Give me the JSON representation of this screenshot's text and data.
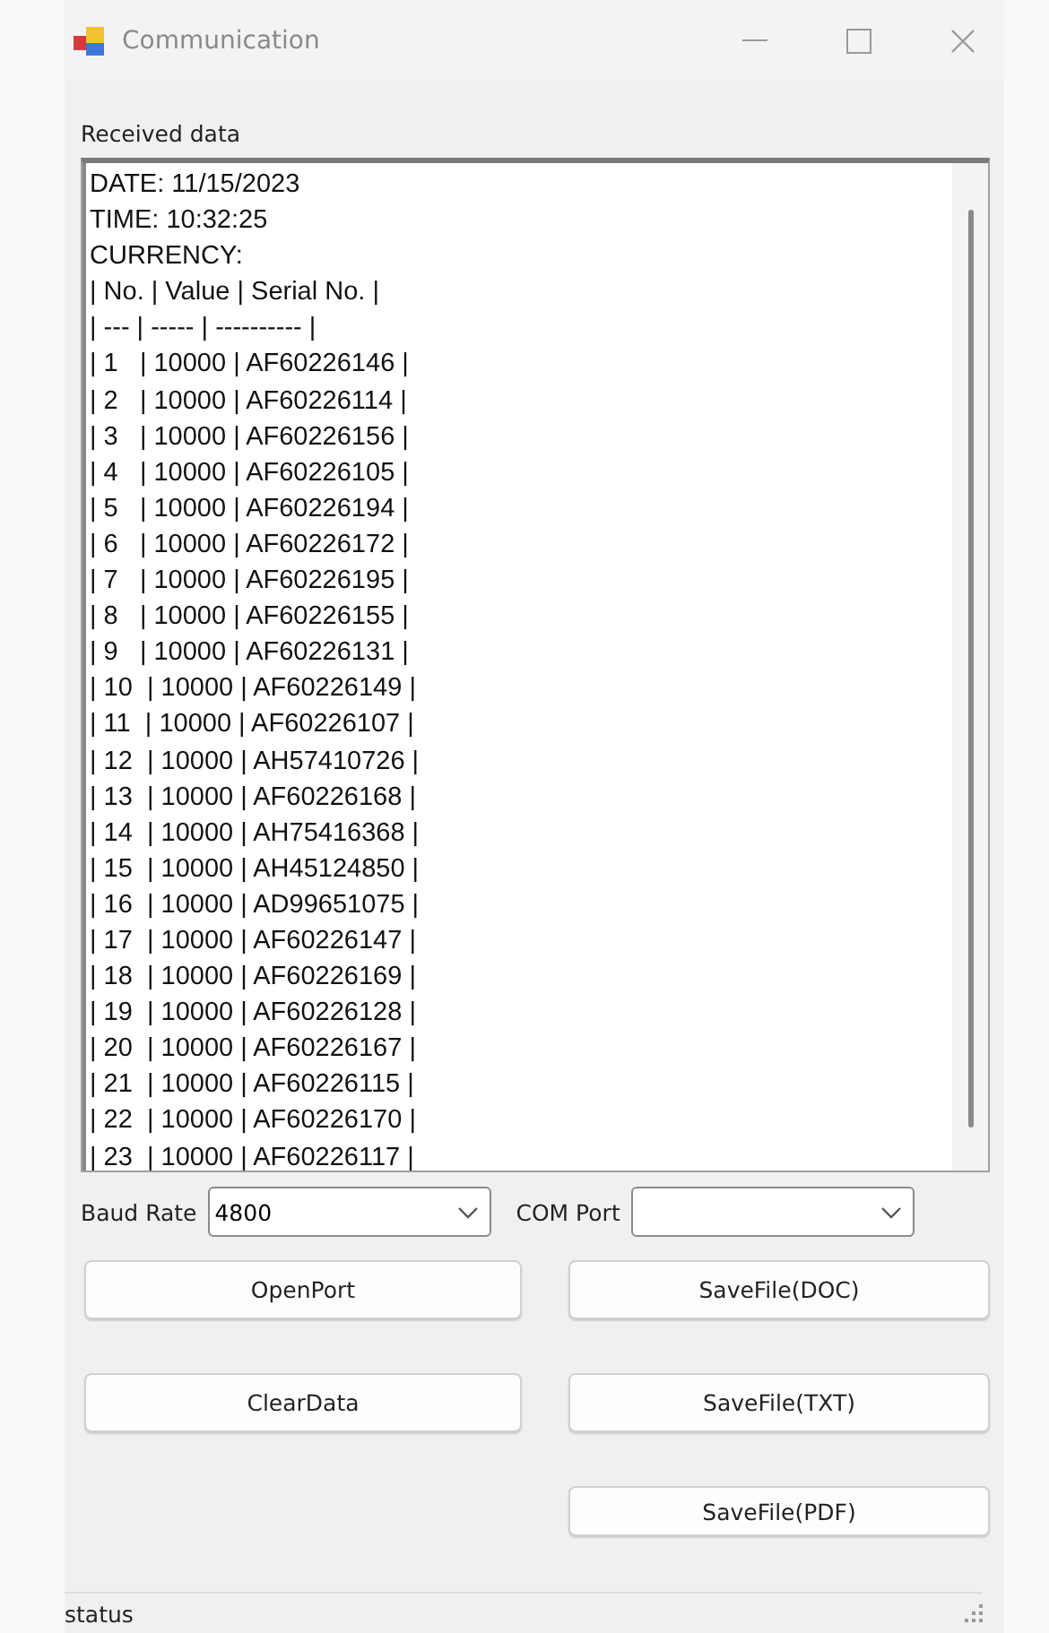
{
  "window": {
    "title": "Communication"
  },
  "received_label": "Received data",
  "received_lines": [
    "DATE: 11/15/2023",
    "TIME: 10:32:25",
    "CURRENCY:",
    "| No. | Value | Serial No. |",
    "| --- | ----- | ---------- |",
    "| 1   | 10000 | AF60226146 |",
    "| 2   | 10000 | AF60226114 |",
    "| 3   | 10000 | AF60226156 |",
    "| 4   | 10000 | AF60226105 |",
    "| 5   | 10000 | AF60226194 |",
    "| 6   | 10000 | AF60226172 |",
    "| 7   | 10000 | AF60226195 |",
    "| 8   | 10000 | AF60226155 |",
    "| 9   | 10000 | AF60226131 |",
    "| 10  | 10000 | AF60226149 |",
    "| 11  | 10000 | AF60226107 |",
    "| 12  | 10000 | AH57410726 |",
    "| 13  | 10000 | AF60226168 |",
    "| 14  | 10000 | AH75416368 |",
    "| 15  | 10000 | AH45124850 |",
    "| 16  | 10000 | AD99651075 |",
    "| 17  | 10000 | AF60226147 |",
    "| 18  | 10000 | AF60226169 |",
    "| 19  | 10000 | AF60226128 |",
    "| 20  | 10000 | AF60226167 |",
    "| 21  | 10000 | AF60226115 |",
    "| 22  | 10000 | AF60226170 |",
    "| 23  | 10000 | AF60226117 |"
  ],
  "baud_rate": {
    "label": "Baud Rate",
    "value": "4800"
  },
  "com_port": {
    "label": "COM Port"
  },
  "left_buttons": [
    "OpenPort",
    "ClearData"
  ],
  "right_buttons": [
    "SaveFile(DOC)",
    "SaveFile(TXT)",
    "SaveFile(PDF)"
  ],
  "status_bar": "status"
}
